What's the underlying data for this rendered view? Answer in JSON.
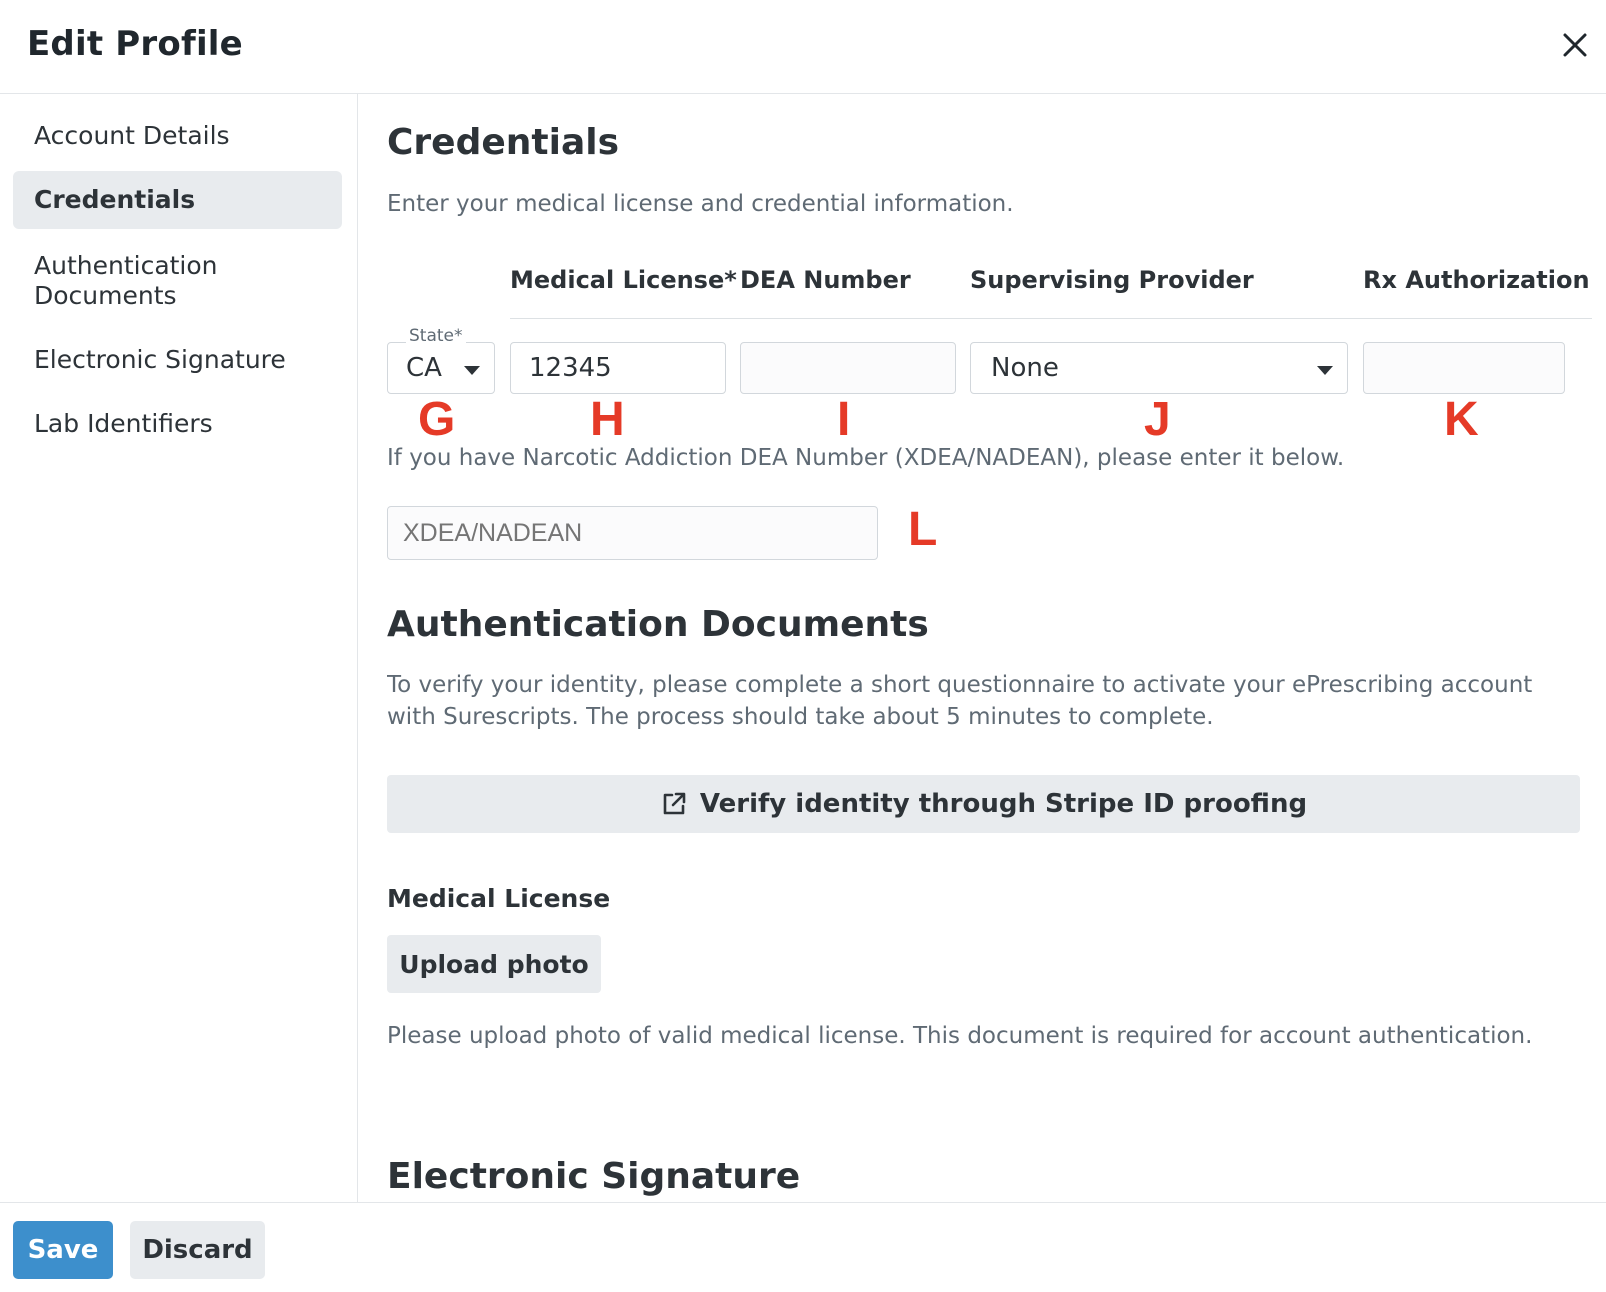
{
  "header": {
    "title": "Edit Profile",
    "close_icon": "close-icon"
  },
  "sidebar": {
    "items": [
      {
        "label": "Account Details",
        "active": false
      },
      {
        "label": "Credentials",
        "active": true
      },
      {
        "label": "Authentication Documents",
        "active": false
      },
      {
        "label": "Electronic Signature",
        "active": false
      },
      {
        "label": "Lab Identifiers",
        "active": false
      }
    ]
  },
  "credentials": {
    "title": "Credentials",
    "description": "Enter your medical license and credential information.",
    "columns": {
      "medical_license": "Medical License*",
      "dea_number": "DEA Number",
      "supervising_provider": "Supervising Provider",
      "rx_authorization": "Rx Authorization"
    },
    "state": {
      "label": "State*",
      "value": "CA"
    },
    "medical_license_value": "12345",
    "dea_number_value": "",
    "supervising_provider_value": "None",
    "rx_authorization_value": "",
    "markers": {
      "state": "G",
      "medical_license": "H",
      "dea": "I",
      "supervising": "J",
      "rx": "K",
      "xdea": "L"
    },
    "xdea_note": "If you have Narcotic Addiction DEA Number (XDEA/NADEAN), please enter it below.",
    "xdea_placeholder": "XDEA/NADEAN"
  },
  "auth_docs": {
    "title": "Authentication Documents",
    "description": "To verify your identity, please complete a short questionnaire to activate your ePrescribing account with Surescripts. The process should take about 5 minutes to complete.",
    "verify_label": "Verify identity through Stripe ID proofing",
    "verify_icon": "external-link-icon",
    "medical_license_label": "Medical License",
    "upload_label": "Upload photo",
    "upload_note": "Please upload photo of valid medical license. This document is required for account authentication."
  },
  "next_section": {
    "title": "Electronic Signature"
  },
  "footer": {
    "save_label": "Save",
    "discard_label": "Discard"
  },
  "colors": {
    "primary": "#3d8fcc",
    "marker": "#e53a27",
    "button_bg": "#e8ebee"
  }
}
